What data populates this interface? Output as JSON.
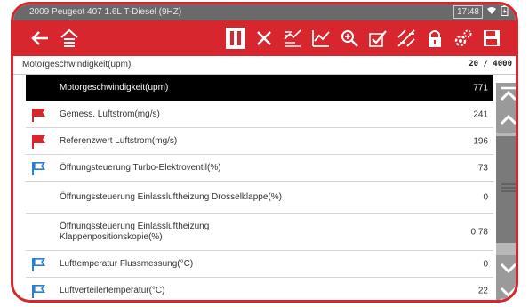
{
  "statusbar": {
    "title": "2009 Peugeot 407 1.6L T-Diesel (9HZ)",
    "time": "17:48",
    "wifi_icon": "wifi-icon",
    "battery_icon": "battery-icon"
  },
  "toolbar": {
    "back_icon": "back-arrow-icon",
    "home_icon": "home-icon",
    "pause_icon": "pause-icon",
    "clear_icon": "close-icon",
    "graph_icon": "graph-view-icon",
    "line_icon": "line-chart-icon",
    "zoom_icon": "zoom-icon",
    "check_icon": "checkmark-icon",
    "compare_icon": "compare-icon",
    "lock_icon": "lock-icon",
    "settings_icon": "settings-icon",
    "save_icon": "save-icon"
  },
  "header": {
    "selected_param": "Motorgeschwindigkeit(upm)",
    "count": "20 / 4000"
  },
  "rows": [
    {
      "label": "Motorgeschwindigkeit(upm)",
      "value": "771",
      "flag": "none",
      "selected": true
    },
    {
      "label": "Gemess. Luftstrom(mg/s)",
      "value": "241",
      "flag": "red"
    },
    {
      "label": "Referenzwert Luftstrom(mg/s)",
      "value": "196",
      "flag": "red"
    },
    {
      "label": "Öffnungsteuerung Turbo-Elektroventil(%)",
      "value": "73",
      "flag": "blue"
    },
    {
      "label": "Öffnungssteuerung Einlassluftheizung Drosselklappe(%)",
      "value": "0",
      "flag": "none"
    },
    {
      "label_line1": "Öffnungssteuerung Einlassluftheizung",
      "label_line2": "Klappenpositionskopie(%)",
      "value": "0.78",
      "flag": "none"
    },
    {
      "label": "Lufttemperatur Flussmessung(°C)",
      "value": "0",
      "flag": "blue"
    },
    {
      "label": "Luftverteilertemperatur(°C)",
      "value": "22",
      "flag": "blue"
    }
  ],
  "colors": {
    "brand_red": "#d8262e",
    "flag_blue": "#2a7fd0",
    "selected_bg": "#000000"
  }
}
